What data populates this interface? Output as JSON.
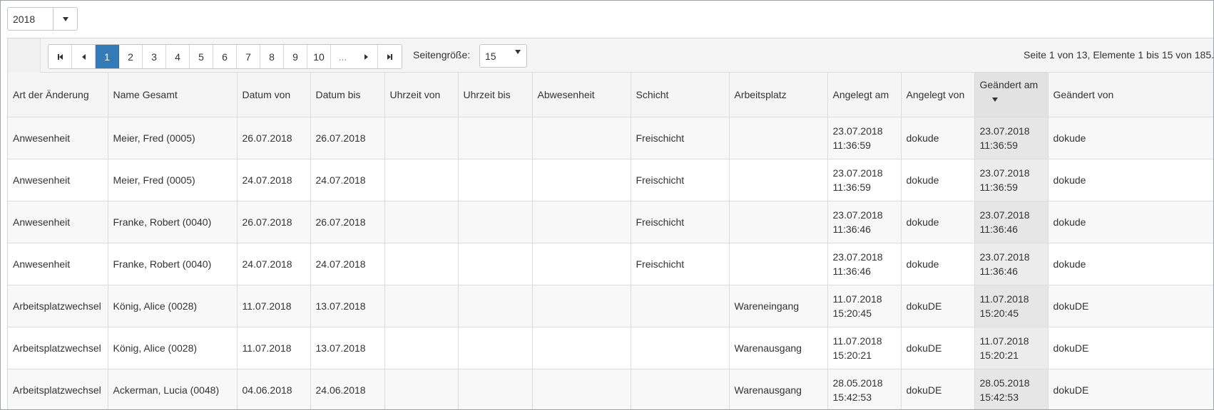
{
  "year_filter": {
    "value": "2018"
  },
  "pager": {
    "pages": [
      "1",
      "2",
      "3",
      "4",
      "5",
      "6",
      "7",
      "8",
      "9",
      "10",
      "..."
    ],
    "active_page": "1",
    "page_size_label": "Seitengröße:",
    "page_size_value": "15",
    "info": "Seite 1 von 13, Elemente 1 bis 15 von 185."
  },
  "table": {
    "columns": [
      "Art der Änderung",
      "Name Gesamt",
      "Datum von",
      "Datum bis",
      "Uhrzeit von",
      "Uhrzeit bis",
      "Abwesenheit",
      "Schicht",
      "Arbeitsplatz",
      "Angelegt am",
      "Angelegt von",
      "Geändert am",
      "Geändert von"
    ],
    "sorted_column": "Geändert am",
    "sort_direction": "descending",
    "rows": [
      {
        "art": "Anwesenheit",
        "name": "Meier, Fred (0005)",
        "datum_von": "26.07.2018",
        "datum_bis": "26.07.2018",
        "uhrzeit_von": "",
        "uhrzeit_bis": "",
        "abwesenheit": "",
        "schicht": "Freischicht",
        "arbeitsplatz": "",
        "angelegt_am_date": "23.07.2018",
        "angelegt_am_time": "11:36:59",
        "angelegt_von": "dokude",
        "geaendert_am_date": "23.07.2018",
        "geaendert_am_time": "11:36:59",
        "geaendert_von": "dokude"
      },
      {
        "art": "Anwesenheit",
        "name": "Meier, Fred (0005)",
        "datum_von": "24.07.2018",
        "datum_bis": "24.07.2018",
        "uhrzeit_von": "",
        "uhrzeit_bis": "",
        "abwesenheit": "",
        "schicht": "Freischicht",
        "arbeitsplatz": "",
        "angelegt_am_date": "23.07.2018",
        "angelegt_am_time": "11:36:59",
        "angelegt_von": "dokude",
        "geaendert_am_date": "23.07.2018",
        "geaendert_am_time": "11:36:59",
        "geaendert_von": "dokude"
      },
      {
        "art": "Anwesenheit",
        "name": "Franke, Robert (0040)",
        "datum_von": "26.07.2018",
        "datum_bis": "26.07.2018",
        "uhrzeit_von": "",
        "uhrzeit_bis": "",
        "abwesenheit": "",
        "schicht": "Freischicht",
        "arbeitsplatz": "",
        "angelegt_am_date": "23.07.2018",
        "angelegt_am_time": "11:36:46",
        "angelegt_von": "dokude",
        "geaendert_am_date": "23.07.2018",
        "geaendert_am_time": "11:36:46",
        "geaendert_von": "dokude"
      },
      {
        "art": "Anwesenheit",
        "name": "Franke, Robert (0040)",
        "datum_von": "24.07.2018",
        "datum_bis": "24.07.2018",
        "uhrzeit_von": "",
        "uhrzeit_bis": "",
        "abwesenheit": "",
        "schicht": "Freischicht",
        "arbeitsplatz": "",
        "angelegt_am_date": "23.07.2018",
        "angelegt_am_time": "11:36:46",
        "angelegt_von": "dokude",
        "geaendert_am_date": "23.07.2018",
        "geaendert_am_time": "11:36:46",
        "geaendert_von": "dokude"
      },
      {
        "art": "Arbeitsplatzwechsel",
        "name": "König, Alice (0028)",
        "datum_von": "11.07.2018",
        "datum_bis": "13.07.2018",
        "uhrzeit_von": "",
        "uhrzeit_bis": "",
        "abwesenheit": "",
        "schicht": "",
        "arbeitsplatz": "Wareneingang",
        "angelegt_am_date": "11.07.2018",
        "angelegt_am_time": "15:20:45",
        "angelegt_von": "dokuDE",
        "geaendert_am_date": "11.07.2018",
        "geaendert_am_time": "15:20:45",
        "geaendert_von": "dokuDE"
      },
      {
        "art": "Arbeitsplatzwechsel",
        "name": "König, Alice (0028)",
        "datum_von": "11.07.2018",
        "datum_bis": "13.07.2018",
        "uhrzeit_von": "",
        "uhrzeit_bis": "",
        "abwesenheit": "",
        "schicht": "",
        "arbeitsplatz": "Warenausgang",
        "angelegt_am_date": "11.07.2018",
        "angelegt_am_time": "15:20:21",
        "angelegt_von": "dokuDE",
        "geaendert_am_date": "11.07.2018",
        "geaendert_am_time": "15:20:21",
        "geaendert_von": "dokuDE"
      },
      {
        "art": "Arbeitsplatzwechsel",
        "name": "Ackerman, Lucia (0048)",
        "datum_von": "04.06.2018",
        "datum_bis": "24.06.2018",
        "uhrzeit_von": "",
        "uhrzeit_bis": "",
        "abwesenheit": "",
        "schicht": "",
        "arbeitsplatz": "Warenausgang",
        "angelegt_am_date": "28.05.2018",
        "angelegt_am_time": "15:42:53",
        "angelegt_von": "dokuDE",
        "geaendert_am_date": "28.05.2018",
        "geaendert_am_time": "15:42:53",
        "geaendert_von": "dokuDE"
      }
    ]
  },
  "icons": {
    "first_page": "first-page-icon",
    "prev_page": "prev-page-icon",
    "next_page": "next-page-icon",
    "last_page": "last-page-icon",
    "dropdown": "chevron-down-icon",
    "sort": "sort-descending-icon"
  },
  "colors": {
    "accent": "#337ab7",
    "header_bg": "#f5f5f5",
    "sorted_column_bg": "#e2e2e2"
  }
}
